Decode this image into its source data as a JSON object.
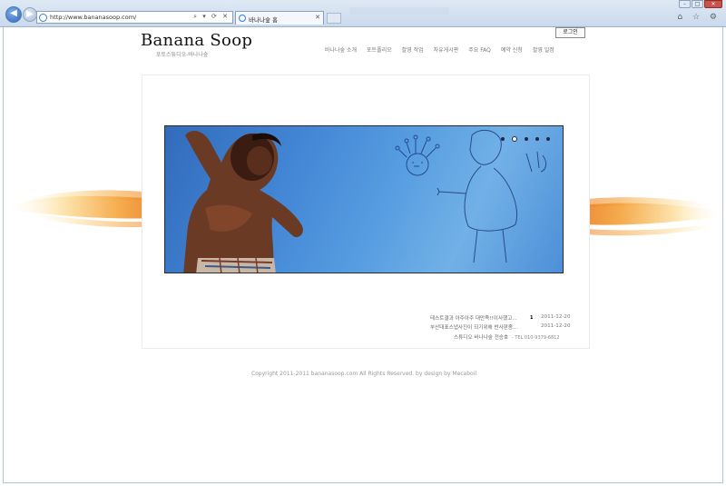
{
  "browser": {
    "url": "http://www.bananasoop.com/",
    "tab_title": "바나나숲 홈",
    "address_tools": "⌕ ▾ ⟳ ✕",
    "tab_close": "✕",
    "right_tools": "⌂ ☆ ⚙"
  },
  "header": {
    "login_label": "로그인",
    "logo": "Banana Soop",
    "logo_sub": "포토스튜디오-바나나숲",
    "menu": [
      "바나나숲 소개",
      "포트폴리오",
      "촬영 작업",
      "자유게시판",
      "주요 FAQ",
      "예약 신청",
      "촬영 일정"
    ]
  },
  "news": [
    {
      "title": "테스트결과 아주아주 대만족!!이사했고...",
      "badge": "1",
      "date": "2011-12-20"
    },
    {
      "title": "부산대표스냅사진이 되기위해 반사판좀...",
      "badge": "",
      "date": "2011-12-20"
    }
  ],
  "contact": {
    "text": "스튜디오 바나나숲 전승호",
    "tel": "- TEL 010-9379-6812"
  },
  "footer": {
    "text": "Copyright 2011-2011 bananasoop.com All Rights Reserved. by design by Mecaboil"
  },
  "slider": {
    "slide_count": 5,
    "active_index": 1
  },
  "colors": {
    "banner_blue": "#3f82d4",
    "flame": "#f0a030"
  }
}
